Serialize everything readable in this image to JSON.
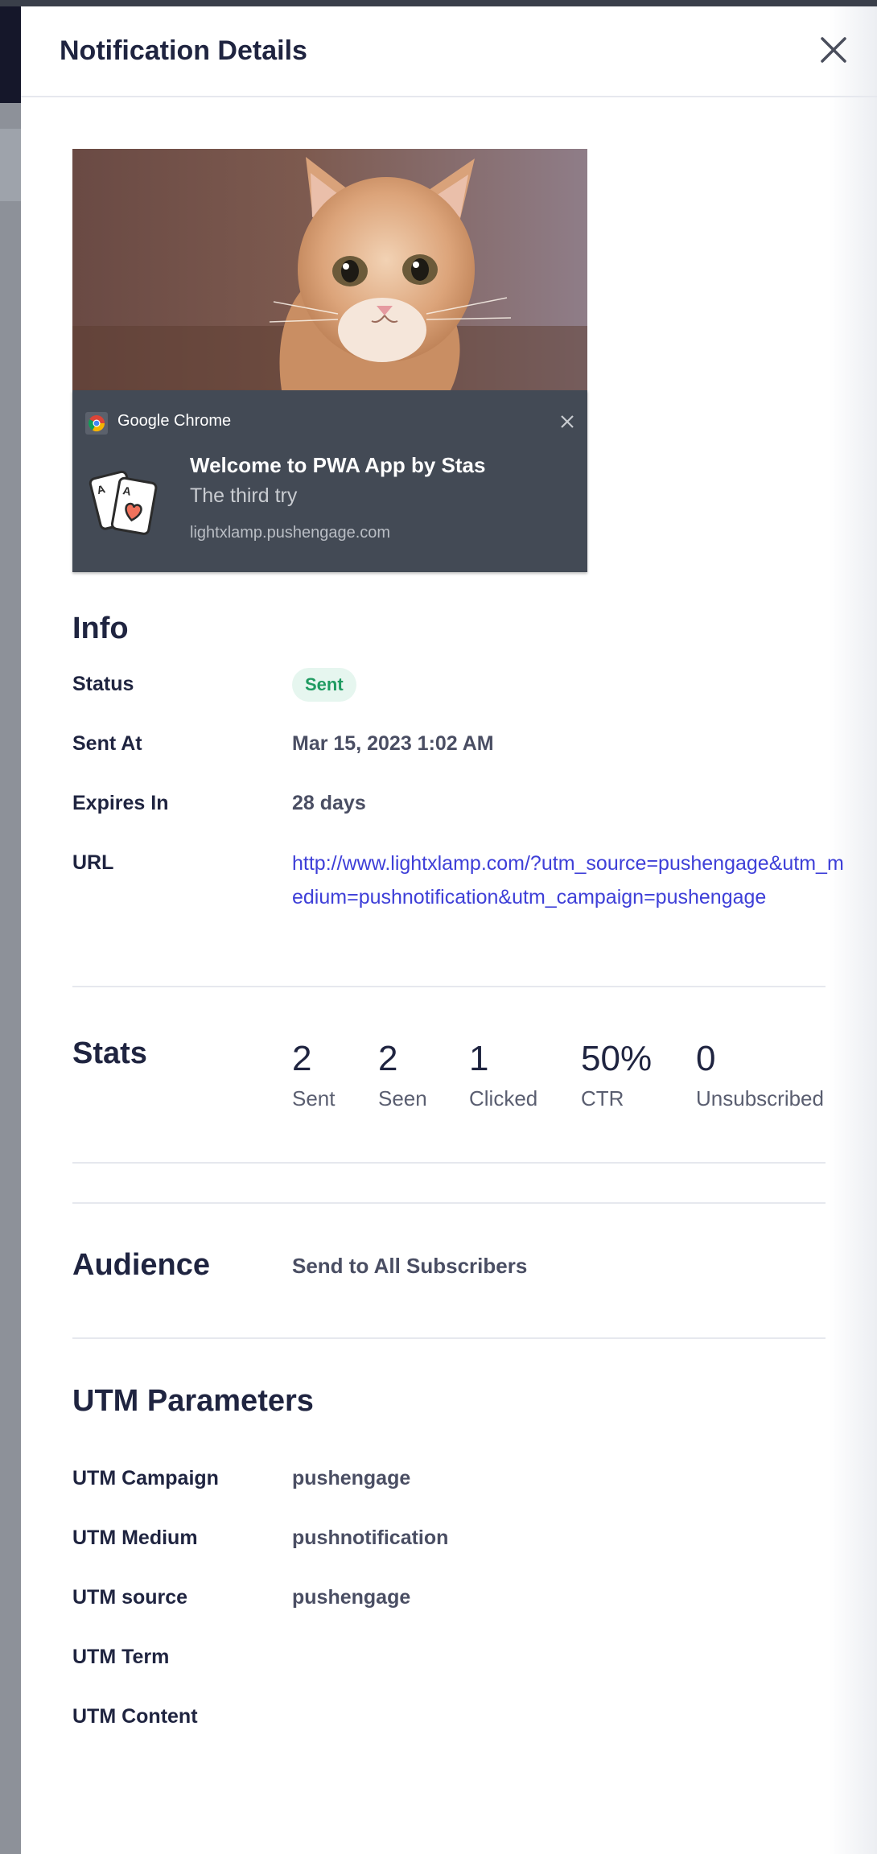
{
  "header": {
    "title": "Notification Details",
    "close_icon": "close-icon"
  },
  "preview": {
    "browser": "Google Chrome",
    "title": "Welcome to PWA App by Stas",
    "body": "The third try",
    "domain": "lightxlamp.pushengage.com",
    "image": "kitten-photo",
    "app_icon": "playing-cards-heart-icon"
  },
  "info": {
    "heading": "Info",
    "status_label": "Status",
    "status_value": "Sent",
    "sent_at_label": "Sent At",
    "sent_at_value": "Mar 15, 2023 1:02 AM",
    "expires_label": "Expires In",
    "expires_value": "28 days",
    "url_label": "URL",
    "url_value": "http://www.lightxlamp.com/?utm_source=pushengage&utm_medium=pushnotification&utm_campaign=pushengage"
  },
  "stats": {
    "heading": "Stats",
    "items": [
      {
        "value": "2",
        "label": "Sent"
      },
      {
        "value": "2",
        "label": "Seen"
      },
      {
        "value": "1",
        "label": "Clicked"
      },
      {
        "value": "50%",
        "label": "CTR"
      },
      {
        "value": "0",
        "label": "Unsubscribed"
      }
    ]
  },
  "audience": {
    "heading": "Audience",
    "value": "Send to All Subscribers"
  },
  "utm": {
    "heading": "UTM Parameters",
    "rows": [
      {
        "label": "UTM Campaign",
        "value": "pushengage"
      },
      {
        "label": "UTM Medium",
        "value": "pushnotification"
      },
      {
        "label": "UTM source",
        "value": "pushengage"
      },
      {
        "label": "UTM Term",
        "value": ""
      },
      {
        "label": "UTM Content",
        "value": ""
      }
    ]
  },
  "colors": {
    "link": "#3e3fd8",
    "status_green": "#1f9b61",
    "notif_bg": "#434a55",
    "title": "#1f2440"
  }
}
